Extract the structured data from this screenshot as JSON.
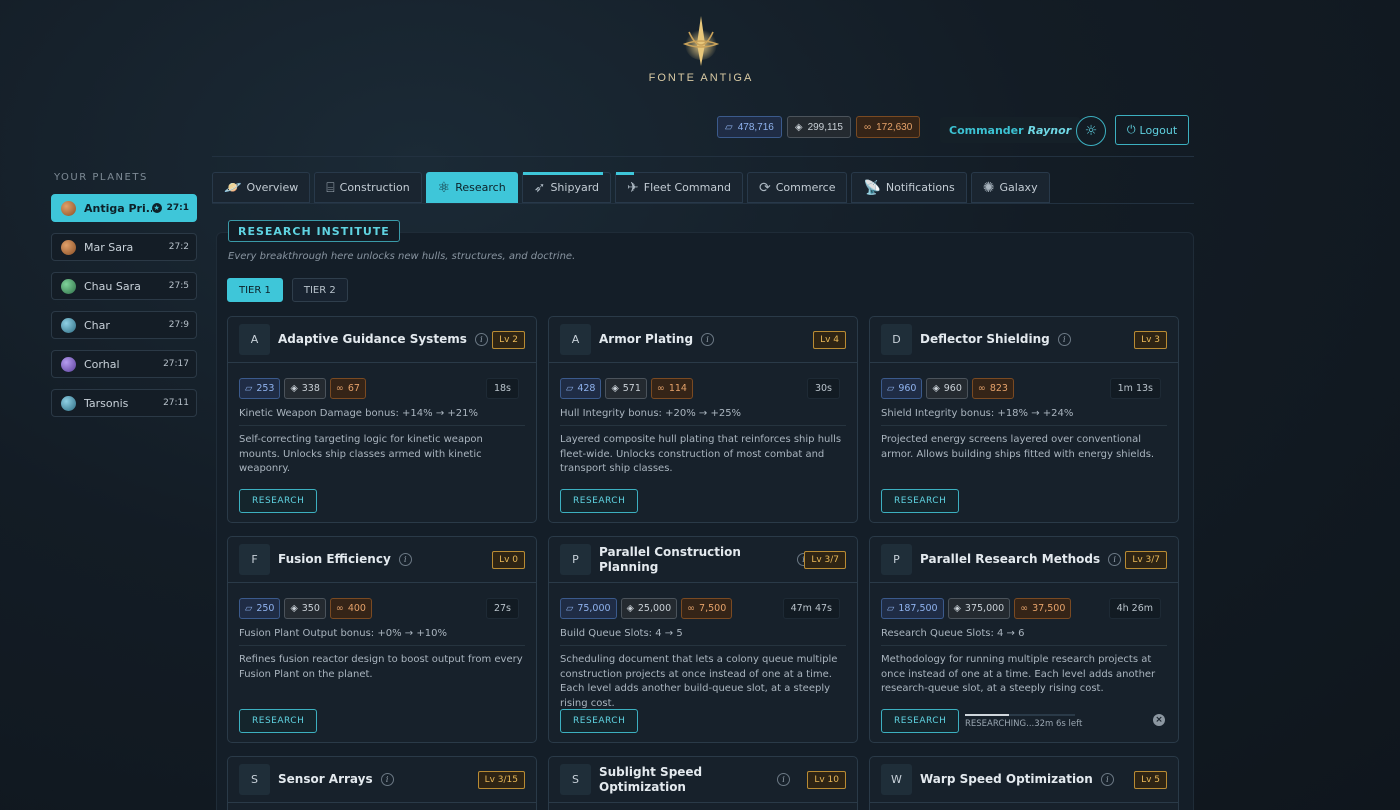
{
  "brand": {
    "name": "FONTE ANTIGA"
  },
  "resources": {
    "metal": "478,716",
    "crystal": "299,115",
    "gas": "172,630"
  },
  "user": {
    "rank": "Commander",
    "name": "Raynor"
  },
  "logout_label": "Logout",
  "sidebar": {
    "title": "YOUR PLANETS",
    "planets": [
      {
        "name": "Antiga Pri...",
        "coord": "27:1",
        "color": "#b8733c"
      },
      {
        "name": "Mar Sara",
        "coord": "27:2",
        "color": "#b8733c"
      },
      {
        "name": "Chau Sara",
        "coord": "27:5",
        "color": "#4aa06a"
      },
      {
        "name": "Char",
        "coord": "27:9",
        "color": "#4b9bb5"
      },
      {
        "name": "Corhal",
        "coord": "27:17",
        "color": "#8a6ad0"
      },
      {
        "name": "Tarsonis",
        "coord": "27:11",
        "color": "#4b9bb5"
      }
    ]
  },
  "tabs": [
    "Overview",
    "Construction",
    "Research",
    "Shipyard",
    "Fleet Command",
    "Commerce",
    "Notifications",
    "Galaxy"
  ],
  "institute": {
    "title": "RESEARCH INSTITUTE",
    "subtitle": "Every breakthrough here unlocks new hulls, structures, and doctrine.",
    "tiers": [
      "TIER 1",
      "TIER 2"
    ]
  },
  "cards": [
    {
      "letter": "A",
      "title": "Adaptive Guidance Systems",
      "level": "Lv 2",
      "metal": "253",
      "crystal": "338",
      "gas": "67",
      "time": "18s",
      "bonus": "Kinetic Weapon Damage bonus: +14% → +21%",
      "desc": "Self-correcting targeting logic for kinetic weapon mounts. Unlocks ship classes armed with kinetic weaponry.",
      "button": "RESEARCH"
    },
    {
      "letter": "A",
      "title": "Armor Plating",
      "level": "Lv 4",
      "metal": "428",
      "crystal": "571",
      "gas": "114",
      "time": "30s",
      "bonus": "Hull Integrity bonus: +20% → +25%",
      "desc": "Layered composite hull plating that reinforces ship hulls fleet-wide. Unlocks construction of most combat and transport ship classes.",
      "button": "RESEARCH"
    },
    {
      "letter": "D",
      "title": "Deflector Shielding",
      "level": "Lv 3",
      "metal": "960",
      "crystal": "960",
      "gas": "823",
      "time": "1m 13s",
      "bonus": "Shield Integrity bonus: +18% → +24%",
      "desc": "Projected energy screens layered over conventional armor. Allows building ships fitted with energy shields.",
      "button": "RESEARCH"
    },
    {
      "letter": "F",
      "title": "Fusion Efficiency",
      "level": "Lv 0",
      "metal": "250",
      "crystal": "350",
      "gas": "400",
      "time": "27s",
      "bonus": "Fusion Plant Output bonus: +0% → +10%",
      "desc": "Refines fusion reactor design to boost output from every Fusion Plant on the planet.",
      "button": "RESEARCH"
    },
    {
      "letter": "P",
      "title": "Parallel Construction Planning",
      "level": "Lv 3/7",
      "metal": "75,000",
      "crystal": "25,000",
      "gas": "7,500",
      "time": "47m 47s",
      "bonus": "Build Queue Slots: 4 → 5",
      "desc": "Scheduling document that lets a colony queue multiple construction projects at once instead of one at a time. Each level adds another build-queue slot, at a steeply rising cost.",
      "button": "RESEARCH"
    },
    {
      "letter": "P",
      "title": "Parallel Research Methods",
      "level": "Lv 3/7",
      "metal": "187,500",
      "crystal": "375,000",
      "gas": "37,500",
      "time": "4h 26m",
      "bonus": "Research Queue Slots: 4 → 6",
      "desc": "Methodology for running multiple research projects at once instead of one at a time. Each level adds another research-queue slot, at a steeply rising cost.",
      "button": "RESEARCH",
      "progress_text": "RESEARCHING...32m 6s left",
      "progress": 0.4
    },
    {
      "letter": "S",
      "title": "Sensor Arrays",
      "level": "Lv 3/15"
    },
    {
      "letter": "S",
      "title": "Sublight Speed Optimization",
      "level": "Lv 10"
    },
    {
      "letter": "W",
      "title": "Warp Speed Optimization",
      "level": "Lv 5"
    }
  ],
  "colors": {
    "accent": "#3ec6d9",
    "metal": "#8fb2ee",
    "gas": "#e5a26a",
    "level": "#e9b858"
  }
}
